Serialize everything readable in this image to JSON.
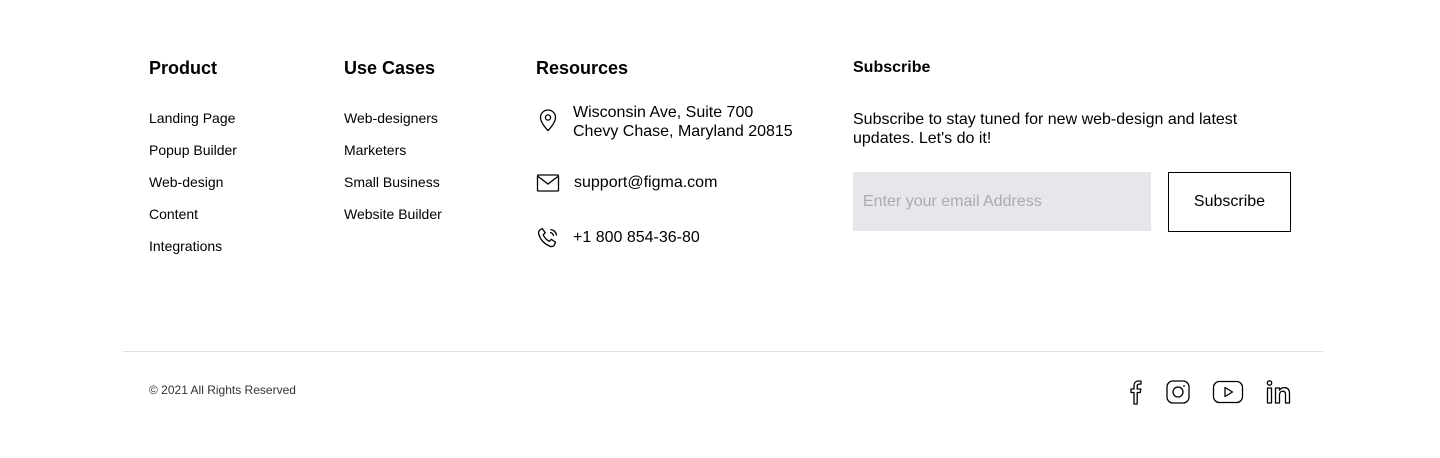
{
  "columns": {
    "product": {
      "title": "Product",
      "links": [
        "Landing Page",
        "Popup Builder",
        "Web-design",
        "Content",
        "Integrations"
      ]
    },
    "use_cases": {
      "title": "Use Cases",
      "links": [
        "Web-designers",
        "Marketers",
        "Small Business",
        "Website Builder"
      ]
    },
    "resources": {
      "title": "Resources",
      "address_line1": "Wisconsin Ave, Suite 700",
      "address_line2": "Chevy Chase, Maryland 20815",
      "email": "support@figma.com",
      "phone": "+1 800 854-36-80",
      "icons": [
        "location-pin-icon",
        "mail-icon",
        "phone-icon"
      ]
    }
  },
  "subscribe": {
    "title": "Subscribe",
    "description": "Subscribe to stay tuned for new web-design and latest updates. Let's do it!",
    "placeholder": "Enter your email Address",
    "button_label": "Subscribe",
    "input_bg": "#e6e7ea"
  },
  "bottom": {
    "copyright": "© 2021 All Rights Reserved",
    "social_icons": [
      "facebook-icon",
      "instagram-icon",
      "youtube-icon",
      "linkedin-icon"
    ]
  }
}
